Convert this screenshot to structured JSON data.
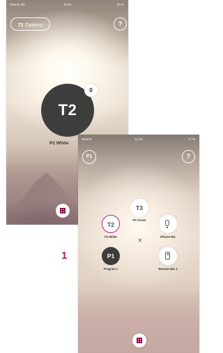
{
  "back_phone": {
    "status": {
      "carrier": "Telenor DK",
      "time": "10.00",
      "battery": "30 %"
    },
    "options_button": {
      "badge": "T2",
      "label": "Options"
    },
    "help_label": "?",
    "active_program": {
      "short": "T2",
      "count": "0",
      "name": "P2 White"
    }
  },
  "front_phone": {
    "status": {
      "left": "Search",
      "time": "12.33",
      "battery": "77 %"
    },
    "program_badge": "P1",
    "help_label": "?",
    "close_label": "×",
    "programs": {
      "t3": {
        "short": "T3",
        "name": "P4 Ocean"
      },
      "t2": {
        "short": "T2",
        "name": "P2 White"
      },
      "p1": {
        "short": "P1",
        "name": "Program 1"
      },
      "iphone_mic": {
        "name": "iPhone Mic"
      },
      "remote_mic": {
        "name": "Remote Mic 1"
      }
    }
  },
  "step_number": "1",
  "colors": {
    "accent": "#a81f74",
    "dark_circle": "#3d3d3d"
  }
}
